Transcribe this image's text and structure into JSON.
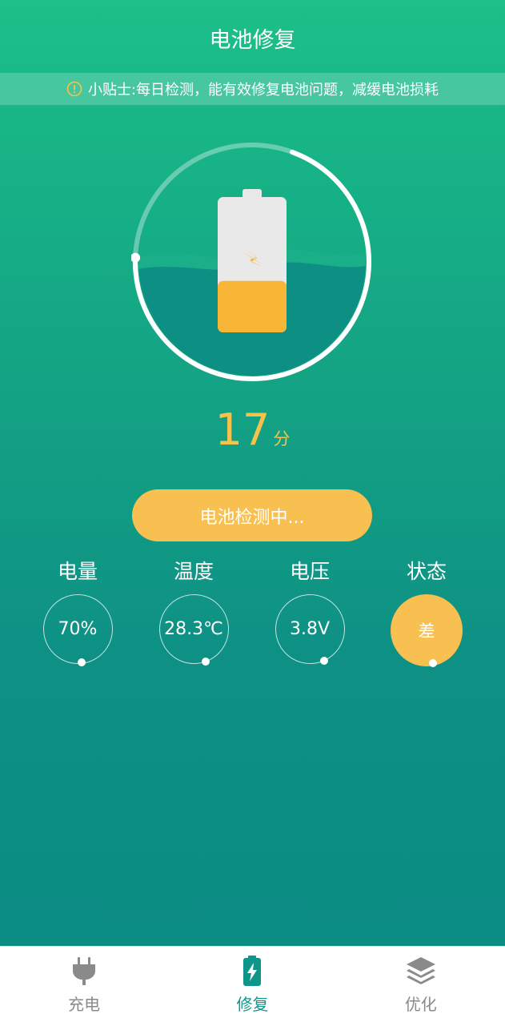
{
  "header": {
    "title": "电池修复"
  },
  "tip": {
    "text": "小贴士:每日检测，能有效修复电池问题，减缓电池损耗",
    "icon": "warning-icon"
  },
  "battery": {
    "icon": "battery-icon",
    "charge_fraction": 0.38,
    "progress_fraction": 0.7
  },
  "score": {
    "value": "17",
    "unit": "分"
  },
  "check_button": {
    "label": "电池检测中..."
  },
  "stats": [
    {
      "label": "电量",
      "value": "70%"
    },
    {
      "label": "温度",
      "value": "28.3℃"
    },
    {
      "label": "电压",
      "value": "3.8V"
    },
    {
      "label": "状态",
      "value": "差"
    }
  ],
  "tabs": [
    {
      "label": "充电",
      "icon": "plug-icon",
      "active": false
    },
    {
      "label": "修复",
      "icon": "battery-charging-icon",
      "active": true
    },
    {
      "label": "优化",
      "icon": "layers-icon",
      "active": false
    }
  ],
  "colors": {
    "accent": "#f8c050",
    "active_tab": "#10958a",
    "inactive_tab": "#8a8a8a"
  }
}
